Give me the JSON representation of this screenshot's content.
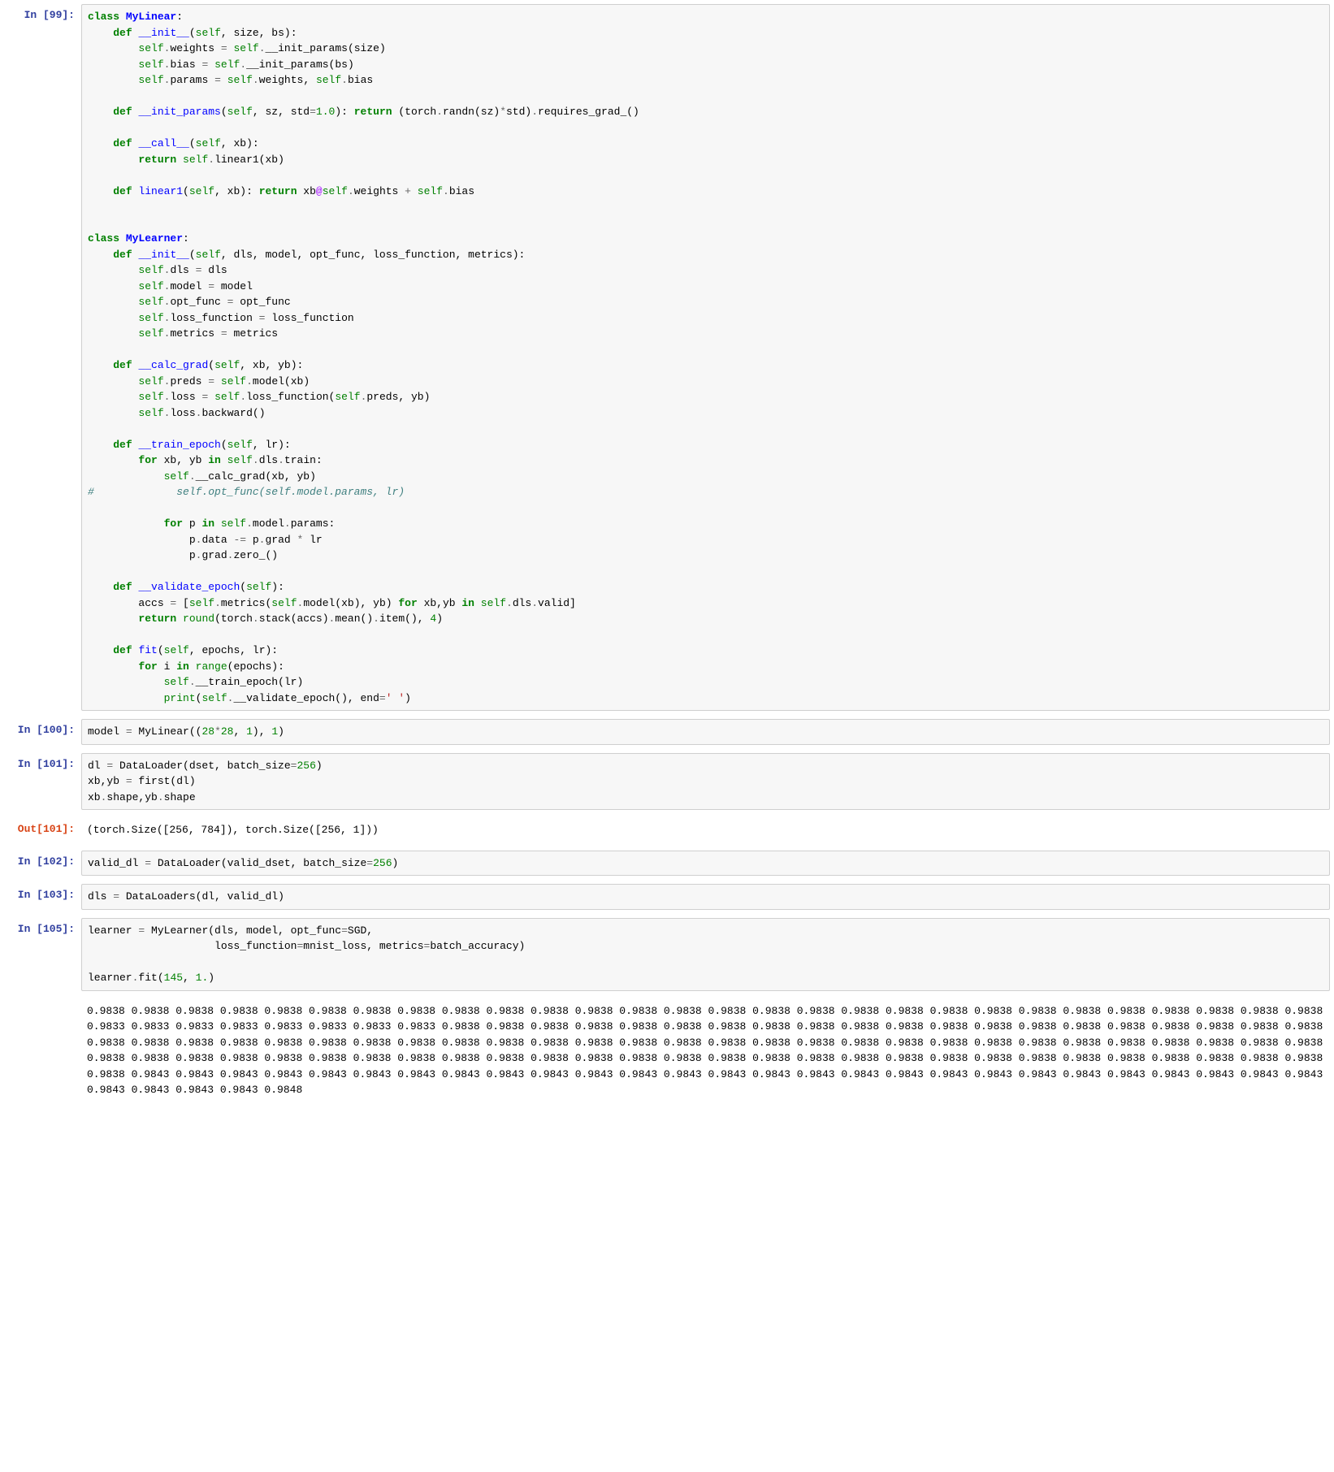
{
  "cells": [
    {
      "prompt_label": "In [99]:",
      "output_label": null,
      "code_tokens": [
        [
          "kw",
          "class"
        ],
        [
          "nn",
          " "
        ],
        [
          "nc",
          "MyLinear"
        ],
        [
          "nn",
          ":\n    "
        ],
        [
          "kw",
          "def"
        ],
        [
          "nn",
          " "
        ],
        [
          "nf",
          "__init__"
        ],
        [
          "nn",
          "("
        ],
        [
          "bp",
          "self"
        ],
        [
          "nn",
          ", size, bs):\n        "
        ],
        [
          "bp",
          "self"
        ],
        [
          "o",
          "."
        ],
        [
          "nn",
          "weights "
        ],
        [
          "o",
          "="
        ],
        [
          "nn",
          " "
        ],
        [
          "bp",
          "self"
        ],
        [
          "o",
          "."
        ],
        [
          "nn",
          "__init_params(size)\n        "
        ],
        [
          "bp",
          "self"
        ],
        [
          "o",
          "."
        ],
        [
          "nn",
          "bias "
        ],
        [
          "o",
          "="
        ],
        [
          "nn",
          " "
        ],
        [
          "bp",
          "self"
        ],
        [
          "o",
          "."
        ],
        [
          "nn",
          "__init_params(bs)\n        "
        ],
        [
          "bp",
          "self"
        ],
        [
          "o",
          "."
        ],
        [
          "nn",
          "params "
        ],
        [
          "o",
          "="
        ],
        [
          "nn",
          " "
        ],
        [
          "bp",
          "self"
        ],
        [
          "o",
          "."
        ],
        [
          "nn",
          "weights, "
        ],
        [
          "bp",
          "self"
        ],
        [
          "o",
          "."
        ],
        [
          "nn",
          "bias\n\n    "
        ],
        [
          "kw",
          "def"
        ],
        [
          "nn",
          " "
        ],
        [
          "nf",
          "__init_params"
        ],
        [
          "nn",
          "("
        ],
        [
          "bp",
          "self"
        ],
        [
          "nn",
          ", sz, std"
        ],
        [
          "o",
          "="
        ],
        [
          "mi",
          "1.0"
        ],
        [
          "nn",
          "): "
        ],
        [
          "kw",
          "return"
        ],
        [
          "nn",
          " (torch"
        ],
        [
          "o",
          "."
        ],
        [
          "nn",
          "randn(sz)"
        ],
        [
          "o",
          "*"
        ],
        [
          "nn",
          "std)"
        ],
        [
          "o",
          "."
        ],
        [
          "nn",
          "requires_grad_()\n\n    "
        ],
        [
          "kw",
          "def"
        ],
        [
          "nn",
          " "
        ],
        [
          "nf",
          "__call__"
        ],
        [
          "nn",
          "("
        ],
        [
          "bp",
          "self"
        ],
        [
          "nn",
          ", xb):\n        "
        ],
        [
          "kw",
          "return"
        ],
        [
          "nn",
          " "
        ],
        [
          "bp",
          "self"
        ],
        [
          "o",
          "."
        ],
        [
          "nn",
          "linear1(xb)\n\n    "
        ],
        [
          "kw",
          "def"
        ],
        [
          "nn",
          " "
        ],
        [
          "nf",
          "linear1"
        ],
        [
          "nn",
          "("
        ],
        [
          "bp",
          "self"
        ],
        [
          "nn",
          ", xb): "
        ],
        [
          "kw",
          "return"
        ],
        [
          "nn",
          " xb"
        ],
        [
          "op",
          "@"
        ],
        [
          "bp",
          "self"
        ],
        [
          "o",
          "."
        ],
        [
          "nn",
          "weights "
        ],
        [
          "o",
          "+"
        ],
        [
          "nn",
          " "
        ],
        [
          "bp",
          "self"
        ],
        [
          "o",
          "."
        ],
        [
          "nn",
          "bias\n\n\n"
        ],
        [
          "kw",
          "class"
        ],
        [
          "nn",
          " "
        ],
        [
          "nc",
          "MyLearner"
        ],
        [
          "nn",
          ":\n    "
        ],
        [
          "kw",
          "def"
        ],
        [
          "nn",
          " "
        ],
        [
          "nf",
          "__init__"
        ],
        [
          "nn",
          "("
        ],
        [
          "bp",
          "self"
        ],
        [
          "nn",
          ", dls, model, opt_func, loss_function, metrics):\n        "
        ],
        [
          "bp",
          "self"
        ],
        [
          "o",
          "."
        ],
        [
          "nn",
          "dls "
        ],
        [
          "o",
          "="
        ],
        [
          "nn",
          " dls\n        "
        ],
        [
          "bp",
          "self"
        ],
        [
          "o",
          "."
        ],
        [
          "nn",
          "model "
        ],
        [
          "o",
          "="
        ],
        [
          "nn",
          " model\n        "
        ],
        [
          "bp",
          "self"
        ],
        [
          "o",
          "."
        ],
        [
          "nn",
          "opt_func "
        ],
        [
          "o",
          "="
        ],
        [
          "nn",
          " opt_func\n        "
        ],
        [
          "bp",
          "self"
        ],
        [
          "o",
          "."
        ],
        [
          "nn",
          "loss_function "
        ],
        [
          "o",
          "="
        ],
        [
          "nn",
          " loss_function\n        "
        ],
        [
          "bp",
          "self"
        ],
        [
          "o",
          "."
        ],
        [
          "nn",
          "metrics "
        ],
        [
          "o",
          "="
        ],
        [
          "nn",
          " metrics\n\n    "
        ],
        [
          "kw",
          "def"
        ],
        [
          "nn",
          " "
        ],
        [
          "nf",
          "__calc_grad"
        ],
        [
          "nn",
          "("
        ],
        [
          "bp",
          "self"
        ],
        [
          "nn",
          ", xb, yb):\n        "
        ],
        [
          "bp",
          "self"
        ],
        [
          "o",
          "."
        ],
        [
          "nn",
          "preds "
        ],
        [
          "o",
          "="
        ],
        [
          "nn",
          " "
        ],
        [
          "bp",
          "self"
        ],
        [
          "o",
          "."
        ],
        [
          "nn",
          "model(xb)\n        "
        ],
        [
          "bp",
          "self"
        ],
        [
          "o",
          "."
        ],
        [
          "nn",
          "loss "
        ],
        [
          "o",
          "="
        ],
        [
          "nn",
          " "
        ],
        [
          "bp",
          "self"
        ],
        [
          "o",
          "."
        ],
        [
          "nn",
          "loss_function("
        ],
        [
          "bp",
          "self"
        ],
        [
          "o",
          "."
        ],
        [
          "nn",
          "preds, yb)\n        "
        ],
        [
          "bp",
          "self"
        ],
        [
          "o",
          "."
        ],
        [
          "nn",
          "loss"
        ],
        [
          "o",
          "."
        ],
        [
          "nn",
          "backward()\n\n    "
        ],
        [
          "kw",
          "def"
        ],
        [
          "nn",
          " "
        ],
        [
          "nf",
          "__train_epoch"
        ],
        [
          "nn",
          "("
        ],
        [
          "bp",
          "self"
        ],
        [
          "nn",
          ", lr):\n        "
        ],
        [
          "kw",
          "for"
        ],
        [
          "nn",
          " xb, yb "
        ],
        [
          "kw",
          "in"
        ],
        [
          "nn",
          " "
        ],
        [
          "bp",
          "self"
        ],
        [
          "o",
          "."
        ],
        [
          "nn",
          "dls"
        ],
        [
          "o",
          "."
        ],
        [
          "nn",
          "train:\n            "
        ],
        [
          "bp",
          "self"
        ],
        [
          "o",
          "."
        ],
        [
          "nn",
          "__calc_grad(xb, yb)\n"
        ],
        [
          "c1",
          "#             self.opt_func(self.model.params, lr)"
        ],
        [
          "nn",
          "\n\n            "
        ],
        [
          "kw",
          "for"
        ],
        [
          "nn",
          " p "
        ],
        [
          "kw",
          "in"
        ],
        [
          "nn",
          " "
        ],
        [
          "bp",
          "self"
        ],
        [
          "o",
          "."
        ],
        [
          "nn",
          "model"
        ],
        [
          "o",
          "."
        ],
        [
          "nn",
          "params:\n                p"
        ],
        [
          "o",
          "."
        ],
        [
          "nn",
          "data "
        ],
        [
          "o",
          "-="
        ],
        [
          "nn",
          " p"
        ],
        [
          "o",
          "."
        ],
        [
          "nn",
          "grad "
        ],
        [
          "o",
          "*"
        ],
        [
          "nn",
          " lr\n                p"
        ],
        [
          "o",
          "."
        ],
        [
          "nn",
          "grad"
        ],
        [
          "o",
          "."
        ],
        [
          "nn",
          "zero_()\n\n    "
        ],
        [
          "kw",
          "def"
        ],
        [
          "nn",
          " "
        ],
        [
          "nf",
          "__validate_epoch"
        ],
        [
          "nn",
          "("
        ],
        [
          "bp",
          "self"
        ],
        [
          "nn",
          "):\n        accs "
        ],
        [
          "o",
          "="
        ],
        [
          "nn",
          " ["
        ],
        [
          "bp",
          "self"
        ],
        [
          "o",
          "."
        ],
        [
          "nn",
          "metrics("
        ],
        [
          "bp",
          "self"
        ],
        [
          "o",
          "."
        ],
        [
          "nn",
          "model(xb), yb) "
        ],
        [
          "kw",
          "for"
        ],
        [
          "nn",
          " xb,yb "
        ],
        [
          "kw",
          "in"
        ],
        [
          "nn",
          " "
        ],
        [
          "bp",
          "self"
        ],
        [
          "o",
          "."
        ],
        [
          "nn",
          "dls"
        ],
        [
          "o",
          "."
        ],
        [
          "nn",
          "valid]\n        "
        ],
        [
          "kw",
          "return"
        ],
        [
          "nn",
          " "
        ],
        [
          "nb",
          "round"
        ],
        [
          "nn",
          "(torch"
        ],
        [
          "o",
          "."
        ],
        [
          "nn",
          "stack(accs)"
        ],
        [
          "o",
          "."
        ],
        [
          "nn",
          "mean()"
        ],
        [
          "o",
          "."
        ],
        [
          "nn",
          "item(), "
        ],
        [
          "mi",
          "4"
        ],
        [
          "nn",
          ")\n\n    "
        ],
        [
          "kw",
          "def"
        ],
        [
          "nn",
          " "
        ],
        [
          "nf",
          "fit"
        ],
        [
          "nn",
          "("
        ],
        [
          "bp",
          "self"
        ],
        [
          "nn",
          ", epochs, lr):\n        "
        ],
        [
          "kw",
          "for"
        ],
        [
          "nn",
          " i "
        ],
        [
          "kw",
          "in"
        ],
        [
          "nn",
          " "
        ],
        [
          "nb",
          "range"
        ],
        [
          "nn",
          "(epochs):\n            "
        ],
        [
          "bp",
          "self"
        ],
        [
          "o",
          "."
        ],
        [
          "nn",
          "__train_epoch(lr)\n            "
        ],
        [
          "nb",
          "print"
        ],
        [
          "nn",
          "("
        ],
        [
          "bp",
          "self"
        ],
        [
          "o",
          "."
        ],
        [
          "nn",
          "__validate_epoch(), end"
        ],
        [
          "o",
          "="
        ],
        [
          "s",
          "' '"
        ],
        [
          "nn",
          ")"
        ]
      ],
      "output_text": null
    },
    {
      "prompt_label": "In [100]:",
      "output_label": null,
      "code_tokens": [
        [
          "nn",
          "model "
        ],
        [
          "o",
          "="
        ],
        [
          "nn",
          " MyLinear(("
        ],
        [
          "mi",
          "28"
        ],
        [
          "o",
          "*"
        ],
        [
          "mi",
          "28"
        ],
        [
          "nn",
          ", "
        ],
        [
          "mi",
          "1"
        ],
        [
          "nn",
          "), "
        ],
        [
          "mi",
          "1"
        ],
        [
          "nn",
          ")"
        ]
      ],
      "output_text": null
    },
    {
      "prompt_label": "In [101]:",
      "output_label": "Out[101]:",
      "code_tokens": [
        [
          "nn",
          "dl "
        ],
        [
          "o",
          "="
        ],
        [
          "nn",
          " DataLoader(dset, batch_size"
        ],
        [
          "o",
          "="
        ],
        [
          "mi",
          "256"
        ],
        [
          "nn",
          ")\nxb,yb "
        ],
        [
          "o",
          "="
        ],
        [
          "nn",
          " first(dl)\nxb"
        ],
        [
          "o",
          "."
        ],
        [
          "nn",
          "shape,yb"
        ],
        [
          "o",
          "."
        ],
        [
          "nn",
          "shape"
        ]
      ],
      "output_text": "(torch.Size([256, 784]), torch.Size([256, 1]))"
    },
    {
      "prompt_label": "In [102]:",
      "output_label": null,
      "code_tokens": [
        [
          "nn",
          "valid_dl "
        ],
        [
          "o",
          "="
        ],
        [
          "nn",
          " DataLoader(valid_dset, batch_size"
        ],
        [
          "o",
          "="
        ],
        [
          "mi",
          "256"
        ],
        [
          "nn",
          ")"
        ]
      ],
      "output_text": null
    },
    {
      "prompt_label": "In [103]:",
      "output_label": null,
      "code_tokens": [
        [
          "nn",
          "dls "
        ],
        [
          "o",
          "="
        ],
        [
          "nn",
          " DataLoaders(dl, valid_dl)"
        ]
      ],
      "output_text": null
    },
    {
      "prompt_label": "In [105]:",
      "output_label": null,
      "code_tokens": [
        [
          "nn",
          "learner "
        ],
        [
          "o",
          "="
        ],
        [
          "nn",
          " MyLearner(dls, model, opt_func"
        ],
        [
          "o",
          "="
        ],
        [
          "nn",
          "SGD,\n                    loss_function"
        ],
        [
          "o",
          "="
        ],
        [
          "nn",
          "mnist_loss, metrics"
        ],
        [
          "o",
          "="
        ],
        [
          "nn",
          "batch_accuracy)\n\nlearner"
        ],
        [
          "o",
          "."
        ],
        [
          "nn",
          "fit("
        ],
        [
          "mi",
          "145"
        ],
        [
          "nn",
          ", "
        ],
        [
          "mi",
          "1."
        ],
        [
          "nn",
          ")"
        ]
      ],
      "output_text": "0.9838 0.9838 0.9838 0.9838 0.9838 0.9838 0.9838 0.9838 0.9838 0.9838 0.9838 0.9838 0.9838 0.9838 0.9838 0.9838 0.9838 0.9838 0.9838 0.9838 0.9838 0.9838 0.9838 0.9838 0.9838 0.9838 0.9838 0.9838 0.9833 0.9833 0.9833 0.9833 0.9833 0.9833 0.9833 0.9833 0.9838 0.9838 0.9838 0.9838 0.9838 0.9838 0.9838 0.9838 0.9838 0.9838 0.9838 0.9838 0.9838 0.9838 0.9838 0.9838 0.9838 0.9838 0.9838 0.9838 0.9838 0.9838 0.9838 0.9838 0.9838 0.9838 0.9838 0.9838 0.9838 0.9838 0.9838 0.9838 0.9838 0.9838 0.9838 0.9838 0.9838 0.9838 0.9838 0.9838 0.9838 0.9838 0.9838 0.9838 0.9838 0.9838 0.9838 0.9838 0.9838 0.9838 0.9838 0.9838 0.9838 0.9838 0.9838 0.9838 0.9838 0.9838 0.9838 0.9838 0.9838 0.9838 0.9838 0.9838 0.9838 0.9838 0.9838 0.9838 0.9838 0.9838 0.9838 0.9838 0.9838 0.9838 0.9838 0.9838 0.9838 0.9843 0.9843 0.9843 0.9843 0.9843 0.9843 0.9843 0.9843 0.9843 0.9843 0.9843 0.9843 0.9843 0.9843 0.9843 0.9843 0.9843 0.9843 0.9843 0.9843 0.9843 0.9843 0.9843 0.9843 0.9843 0.9843 0.9843 0.9843 0.9843 0.9843 0.9843 0.9848 "
    }
  ]
}
